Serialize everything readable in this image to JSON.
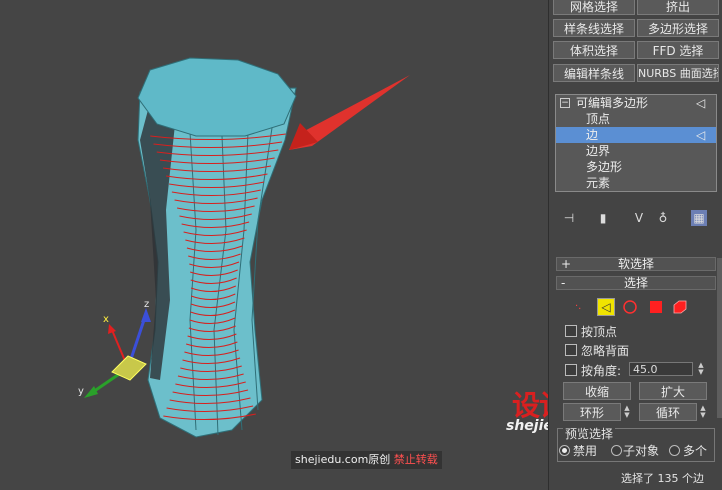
{
  "top_buttons": [
    {
      "label": "网格选择"
    },
    {
      "label": "挤出"
    },
    {
      "label": "样条线选择"
    },
    {
      "label": "多边形选择"
    },
    {
      "label": "体积选择"
    },
    {
      "label": "FFD 选择"
    },
    {
      "label": "编辑样条线"
    },
    {
      "label": "NURBS 曲面选择"
    }
  ],
  "modifier_stack": {
    "root": "可编辑多边形",
    "items": [
      "顶点",
      "边",
      "边界",
      "多边形",
      "元素"
    ],
    "selected": "边"
  },
  "soft_selection": {
    "sign": "+",
    "title": "软选择"
  },
  "selection": {
    "sign": "-",
    "title": "选择",
    "by_vertex": "按顶点",
    "ignore_backfacing": "忽略背面",
    "by_angle": "按角度:",
    "angle_value": "45.0",
    "shrink": "收缩",
    "grow": "扩大",
    "ring": "环形",
    "loop": "循环",
    "preview_selection": "预览选择",
    "preview_options": [
      "禁用",
      "子对象",
      "多个"
    ],
    "status": "选择了 135 个边"
  },
  "axis_labels": {
    "x": "x",
    "y": "y",
    "z": "z"
  },
  "watermark": {
    "logo": "设计大",
    "site": "shejiedu.com"
  },
  "credit": {
    "site": "shejiedu.com原创",
    "note": "禁止转载"
  },
  "colors": {
    "mesh": "#6ec1cc",
    "mesh_top": "#5fb9c8",
    "edge_sel": "#d7201e",
    "highlight": "#5b8fd3",
    "arrow": "#e0322d"
  }
}
